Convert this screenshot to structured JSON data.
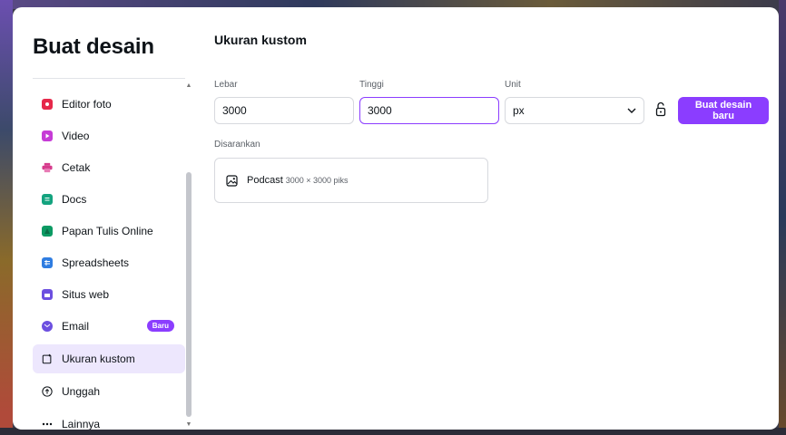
{
  "dialog": {
    "title": "Buat desain"
  },
  "sidebar": {
    "items": [
      {
        "label": "Editor foto",
        "icon": "photo-editor-icon",
        "color": "#e6284a"
      },
      {
        "label": "Video",
        "icon": "video-icon",
        "color": "#c63bd6"
      },
      {
        "label": "Cetak",
        "icon": "print-icon",
        "color": "#d63b8c"
      },
      {
        "label": "Docs",
        "icon": "docs-icon",
        "color": "#14a37f"
      },
      {
        "label": "Papan Tulis Online",
        "icon": "whiteboard-icon",
        "color": "#0c9a63"
      },
      {
        "label": "Spreadsheets",
        "icon": "spreadsheet-icon",
        "color": "#2f7de1"
      },
      {
        "label": "Situs web",
        "icon": "website-icon",
        "color": "#6c4fe0"
      },
      {
        "label": "Email",
        "icon": "email-icon",
        "color": "#6c4fe0",
        "badge": "Baru"
      },
      {
        "label": "Ukuran kustom",
        "icon": "custom-size-icon",
        "color": "#0e1318",
        "active": true
      },
      {
        "label": "Unggah",
        "icon": "upload-icon",
        "color": "#0e1318"
      },
      {
        "label": "Lainnya",
        "icon": "more-icon",
        "color": "#0e1318"
      }
    ]
  },
  "main": {
    "title": "Ukuran kustom",
    "width": {
      "label": "Lebar",
      "value": "3000"
    },
    "height": {
      "label": "Tinggi",
      "value": "3000"
    },
    "unit": {
      "label": "Unit",
      "value": "px"
    },
    "create_button": "Buat desain baru",
    "suggested": {
      "label": "Disarankan",
      "items": [
        {
          "name": "Podcast",
          "size": "3000 × 3000 piks",
          "icon": "image-icon"
        }
      ]
    }
  },
  "colors": {
    "accent": "#8b3dff",
    "active_bg": "#ede7fd"
  }
}
